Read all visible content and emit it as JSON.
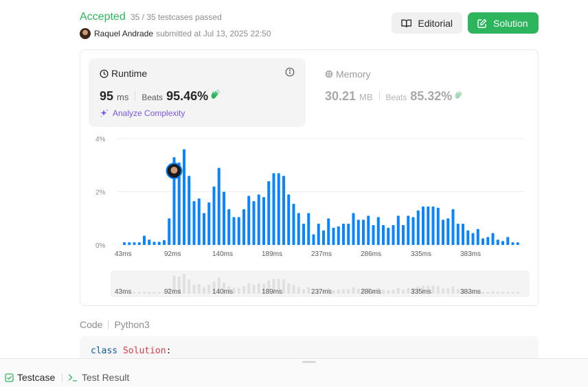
{
  "submission": {
    "status": "Accepted",
    "testcases": "35 / 35 testcases passed",
    "user": "Raquel Andrade",
    "submitted_at": "submitted at Jul 13, 2025 22:50"
  },
  "buttons": {
    "editorial": "Editorial",
    "solution": "Solution"
  },
  "runtime": {
    "title": "Runtime",
    "value": "95",
    "unit": "ms",
    "beats_label": "Beats",
    "beats": "95.46%",
    "analyze": "Analyze Complexity"
  },
  "memory": {
    "title": "Memory",
    "value": "30.21",
    "unit": "MB",
    "beats_label": "Beats",
    "beats": "85.32%"
  },
  "colors": {
    "accent_green": "#2db55d",
    "bar_blue": "#0a84ff",
    "analyze_purple": "#7b55e4"
  },
  "icons": [
    "clock-icon",
    "info-icon",
    "chip-icon",
    "clap-icon",
    "sparkle-icon",
    "book-icon",
    "edit-icon",
    "checkbox-icon",
    "terminal-icon"
  ],
  "chart_data": {
    "type": "bar",
    "ytick_labels": [
      "0%",
      "2%",
      "4%"
    ],
    "ylim": [
      0,
      4
    ],
    "xtick_labels": [
      "43ms",
      "92ms",
      "140ms",
      "189ms",
      "237ms",
      "286ms",
      "335ms",
      "383ms"
    ],
    "values": [
      0.1,
      0.1,
      0.1,
      0.1,
      0.35,
      0.2,
      0.12,
      0.12,
      0.18,
      1.0,
      3.3,
      3.1,
      3.6,
      2.6,
      1.65,
      1.75,
      1.2,
      1.6,
      2.2,
      2.9,
      2.0,
      1.35,
      1.05,
      1.05,
      1.35,
      1.85,
      1.65,
      1.9,
      1.8,
      2.4,
      2.7,
      2.7,
      2.6,
      1.9,
      1.55,
      1.2,
      0.8,
      1.2,
      0.4,
      0.8,
      0.55,
      1.0,
      0.65,
      0.7,
      0.8,
      0.8,
      1.2,
      0.95,
      0.95,
      1.1,
      0.75,
      1.05,
      0.75,
      0.65,
      0.75,
      1.1,
      0.75,
      1.1,
      1.05,
      1.3,
      1.45,
      1.45,
      1.45,
      1.4,
      0.95,
      1.0,
      1.35,
      0.8,
      0.8,
      0.55,
      0.45,
      0.6,
      0.25,
      0.3,
      0.45,
      0.2,
      0.15,
      0.3,
      0.1,
      0.1
    ],
    "highlight_index": 10,
    "grid": true
  }
}
